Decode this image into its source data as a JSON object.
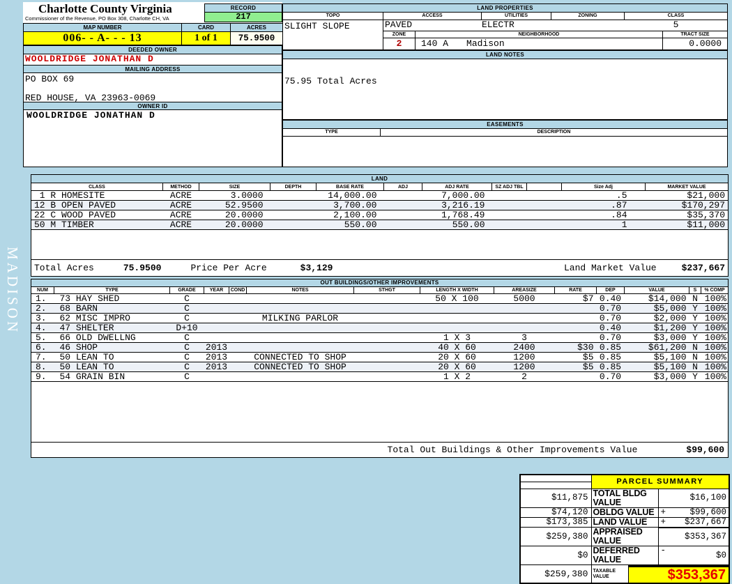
{
  "colors": {
    "page_background": "#b3d7e6",
    "highlight_yellow": "#ffff00",
    "record_green": "#90ee90",
    "acres_ivory": "#fffff0",
    "owner_red": "#cc0000",
    "taxable_red": "#e60000",
    "row_stripe": "#edf1f7"
  },
  "sidebar": {
    "district": "MADISON"
  },
  "header": {
    "county_title": "Charlotte County Virginia",
    "commissioner_line": "Commissioner of the Revenue, PO Box 308, Charlotte CH, VA",
    "record_label": "RECORD",
    "record_value": "217",
    "map_number_label": "MAP NUMBER",
    "map_number_value": "006- - A- - - 13",
    "card_label": "CARD",
    "card_value": "1 of 1",
    "acres_label": "ACRES",
    "acres_value": "75.9500"
  },
  "owner": {
    "deeded_owner_label": "DEEDED OWNER",
    "deeded_owner": "WOOLDRIDGE JONATHAN D",
    "mailing_address_label": "MAILING ADDRESS",
    "address_line1": "PO BOX 69",
    "address_line2": "RED HOUSE, VA 23963-0069",
    "owner_id_label": "OWNER ID",
    "owner_id": "WOOLDRIDGE JONATHAN D"
  },
  "land_properties": {
    "title": "LAND PROPERTIES",
    "topo_label": "TOPO",
    "access_label": "ACCESS",
    "utilities_label": "UTILITIES",
    "zoning_label": "ZONING",
    "class_label": "CLASS",
    "topo": "SLIGHT SLOPE",
    "access": "PAVED",
    "utilities": "ELECTR",
    "zoning": "",
    "class": "5",
    "zone_label": "ZONE",
    "zone": "2",
    "neighborhood_label": "NEIGHBORHOOD",
    "neighborhood_code": "140 A",
    "neighborhood_name": "Madison",
    "tract_size_label": "TRACT SIZE",
    "tract_size": "0.0000"
  },
  "land_notes": {
    "title": "LAND NOTES",
    "note": "75.95 Total Acres"
  },
  "easements": {
    "title": "EASEMENTS",
    "type_label": "TYPE",
    "description_label": "DESCRIPTION"
  },
  "land": {
    "title": "LAND",
    "headers": [
      "CLASS",
      "METHOD",
      "SIZE",
      "DEPTH",
      "BASE RATE",
      "ADJ",
      "ADJ RATE",
      "SZ ADJ TBL",
      "",
      "Size Adj",
      "MARKET VALUE"
    ],
    "rows": [
      {
        "cls": " 1 R HOMESITE",
        "method": "ACRE",
        "size": "3.0000",
        "depth": "",
        "base_rate": "14,000.00",
        "adj": "",
        "adj_rate": "7,000.00",
        "sz_tbl": "",
        "blank": "",
        "size_adj": ".5",
        "market": "$21,000"
      },
      {
        "cls": "12 B OPEN PAVED",
        "method": "ACRE",
        "size": "52.9500",
        "depth": "",
        "base_rate": "3,700.00",
        "adj": "",
        "adj_rate": "3,216.19",
        "sz_tbl": "",
        "blank": "",
        "size_adj": ".87",
        "market": "$170,297"
      },
      {
        "cls": "22 C WOOD PAVED",
        "method": "ACRE",
        "size": "20.0000",
        "depth": "",
        "base_rate": "2,100.00",
        "adj": "",
        "adj_rate": "1,768.49",
        "sz_tbl": "",
        "blank": "",
        "size_adj": ".84",
        "market": "$35,370"
      },
      {
        "cls": "50 M TIMBER",
        "method": "ACRE",
        "size": "20.0000",
        "depth": "",
        "base_rate": "550.00",
        "adj": "",
        "adj_rate": "550.00",
        "sz_tbl": "",
        "blank": "",
        "size_adj": "1",
        "market": "$11,000"
      }
    ],
    "total_acres_label": "Total Acres",
    "total_acres": "75.9500",
    "price_per_acre_label": "Price Per Acre",
    "price_per_acre": "$3,129",
    "land_market_value_label": "Land Market Value",
    "land_market_value": "$237,667"
  },
  "out_buildings": {
    "title": "OUT BUILDINGS/OTHER IMPROVEMENTS",
    "headers": [
      "NUM",
      "TYPE",
      "GRADE",
      "YEAR",
      "COND",
      "NOTES",
      "STHGT",
      "LENGTH X WIDTH",
      "AREASIZE",
      "RATE",
      "DEP",
      "VALUE",
      "S",
      "% COMP"
    ],
    "rows": [
      {
        "num": "1.",
        "type": "73 HAY SHED",
        "grade": "C",
        "year": "",
        "cond": "",
        "notes": "",
        "sthgt": "",
        "lxw": "50 X 100",
        "area": "5000",
        "rate": "$7",
        "dep": "0.40",
        "value": "$14,000",
        "s": "N",
        "comp": "100%"
      },
      {
        "num": "2.",
        "type": "68 BARN",
        "grade": "C",
        "year": "",
        "cond": "",
        "notes": "",
        "sthgt": "",
        "lxw": "",
        "area": "",
        "rate": "",
        "dep": "0.70",
        "value": "$5,000",
        "s": "Y",
        "comp": "100%"
      },
      {
        "num": "3.",
        "type": "62 MISC IMPRO",
        "grade": "C",
        "year": "",
        "cond": "",
        "notes": "MILKING PARLOR",
        "sthgt": "",
        "lxw": "",
        "area": "",
        "rate": "",
        "dep": "0.70",
        "value": "$2,000",
        "s": "Y",
        "comp": "100%"
      },
      {
        "num": "4.",
        "type": "47 SHELTER",
        "grade": "D+10",
        "year": "",
        "cond": "",
        "notes": "",
        "sthgt": "",
        "lxw": "",
        "area": "",
        "rate": "",
        "dep": "0.40",
        "value": "$1,200",
        "s": "Y",
        "comp": "100%"
      },
      {
        "num": "5.",
        "type": "66 OLD DWELLNG",
        "grade": "C",
        "year": "",
        "cond": "",
        "notes": "",
        "sthgt": "",
        "lxw": "1 X 3",
        "area": "3",
        "rate": "",
        "dep": "0.70",
        "value": "$3,000",
        "s": "Y",
        "comp": "100%"
      },
      {
        "num": "6.",
        "type": "46 SHOP",
        "grade": "C",
        "year": "2013",
        "cond": "",
        "notes": "",
        "sthgt": "",
        "lxw": "40 X 60",
        "area": "2400",
        "rate": "$30",
        "dep": "0.85",
        "value": "$61,200",
        "s": "N",
        "comp": "100%"
      },
      {
        "num": "7.",
        "type": "50 LEAN TO",
        "grade": "C",
        "year": "2013",
        "cond": "",
        "notes": "CONNECTED TO SHOP",
        "sthgt": "",
        "lxw": "20 X 60",
        "area": "1200",
        "rate": "$5",
        "dep": "0.85",
        "value": "$5,100",
        "s": "N",
        "comp": "100%"
      },
      {
        "num": "8.",
        "type": "50 LEAN TO",
        "grade": "C",
        "year": "2013",
        "cond": "",
        "notes": "CONNECTED TO SHOP",
        "sthgt": "",
        "lxw": "20 X 60",
        "area": "1200",
        "rate": "$5",
        "dep": "0.85",
        "value": "$5,100",
        "s": "N",
        "comp": "100%"
      },
      {
        "num": "9.",
        "type": "54 GRAIN BIN",
        "grade": "C",
        "year": "",
        "cond": "",
        "notes": "",
        "sthgt": "",
        "lxw": "1 X 2",
        "area": "2",
        "rate": "",
        "dep": "0.70",
        "value": "$3,000",
        "s": "Y",
        "comp": "100%"
      }
    ],
    "total_label": "Total Out Buildings & Other Improvements Value",
    "total_value": "$99,600"
  },
  "parcel_summary": {
    "title": "PARCEL SUMMARY",
    "rows": [
      {
        "prior": "$11,875",
        "label": "TOTAL BLDG VALUE",
        "sign": "",
        "value": "$16,100"
      },
      {
        "prior": "$74,120",
        "label": "OBLDG VALUE",
        "sign": "+",
        "value": "$99,600"
      },
      {
        "prior": "$173,385",
        "label": "LAND VALUE",
        "sign": "+",
        "value": "$237,667"
      },
      {
        "prior": "$259,380",
        "label": "APPRAISED VALUE",
        "sign": "",
        "value": "$353,367"
      },
      {
        "prior": "$0",
        "label": "DEFERRED VALUE",
        "sign": "-",
        "value": "$0"
      }
    ],
    "taxable_prior": "$259,380",
    "taxable_label": "TAXABLE VALUE",
    "taxable_value": "$353,367"
  }
}
